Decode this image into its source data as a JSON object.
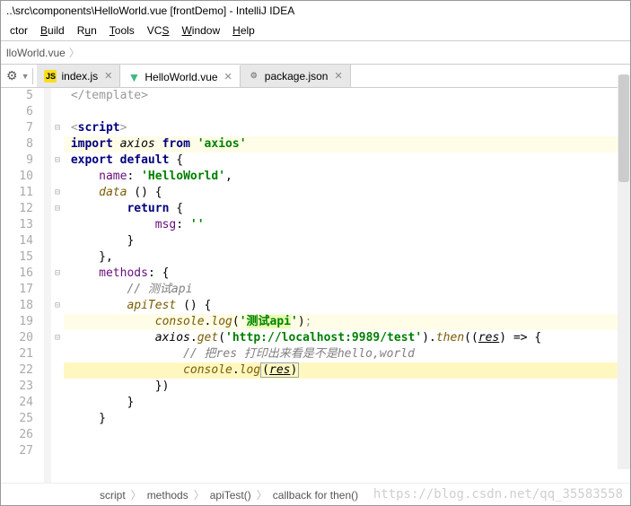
{
  "window": {
    "title": "..\\src\\components\\HelloWorld.vue [frontDemo] - IntelliJ IDEA"
  },
  "menu": {
    "items": [
      {
        "label": "ctor",
        "mnemonic": ""
      },
      {
        "label": "Build",
        "mnemonic": "B"
      },
      {
        "label": "Run",
        "mnemonic": "u"
      },
      {
        "label": "Tools",
        "mnemonic": "T"
      },
      {
        "label": "VCS",
        "mnemonic": "S"
      },
      {
        "label": "Window",
        "mnemonic": "W"
      },
      {
        "label": "Help",
        "mnemonic": "H"
      }
    ]
  },
  "navCrumb": {
    "file": "lloWorld.vue",
    "arrow": "〉"
  },
  "tabs": {
    "items": [
      {
        "label": "index.js",
        "icon": "js",
        "closeable": true
      },
      {
        "label": "HelloWorld.vue",
        "icon": "vue",
        "closeable": true,
        "active": true
      },
      {
        "label": "package.json",
        "icon": "json",
        "closeable": true
      }
    ]
  },
  "gutterStart": 5,
  "code": {
    "5": {
      "html": "<span class='tagc'>&lt;/template&gt;</span>"
    },
    "6": {
      "html": ""
    },
    "7": {
      "html": "<span class='tagc'>&lt;</span><span class='kw'>script</span><span class='tagc'>&gt;</span>",
      "fold": "⊟"
    },
    "8": {
      "html": "<span class='kw'>import</span> <span class='param'>axios</span> <span class='kw'>from</span> <span class='str'>'axios'</span>",
      "hl": true
    },
    "9": {
      "html": "<span class='kw'>export default</span> {",
      "fold": "⊟"
    },
    "10": {
      "html": "  <span class='name'>name</span>: <span class='str'>'HelloWorld'</span>,"
    },
    "11": {
      "html": "  <span class='call'>data</span> () {",
      "fold": "⊟"
    },
    "12": {
      "html": "    <span class='kw'>return</span> {",
      "fold": "⊟"
    },
    "13": {
      "html": "      <span class='name'>msg</span>: <span class='str'>''</span>"
    },
    "14": {
      "html": "    }"
    },
    "15": {
      "html": "  },"
    },
    "16": {
      "html": "  <span class='name'>methods</span>: {",
      "fold": "⊟"
    },
    "17": {
      "html": "    <span class='cmt'>// 测试api</span>"
    },
    "18": {
      "html": "    <span class='call'>apiTest</span> () {",
      "fold": "⊟"
    },
    "19": {
      "html": "      <span class='call'>console</span>.<span class='call'>log</span>(<span class='str'>'<span style=\"background:#e7ffb3;\">测试api</span>'</span>)<span class='tagc'>;</span>",
      "hl": true
    },
    "20": {
      "html": "      <span class='param'>axios</span>.<span class='call'>get</span>(<span class='str'>'http://localhost:9989/test'</span>).<span class='call'>then</span>((<span class='uvar'>res</span>) =&gt; {",
      "fold": "⊟"
    },
    "21": {
      "html": "        <span class='cmt'>// 把res 打印出来看是不是hello,world</span>"
    },
    "22": {
      "html": "        <span class='call'>console</span>.<span class='call'>log</span><span class='box'>(<span class='uvar'>res</span>)</span>",
      "sel": true,
      "bulb": true
    },
    "23": {
      "html": "      })"
    },
    "24": {
      "html": "    }"
    },
    "25": {
      "html": "  }"
    },
    "26": {
      "html": ""
    },
    "27": {
      "html": ""
    }
  },
  "breadcrumb": {
    "items": [
      "script",
      "methods",
      "apiTest()",
      "callback for then()"
    ]
  },
  "watermark": "https://blog.csdn.net/qq_35583558"
}
